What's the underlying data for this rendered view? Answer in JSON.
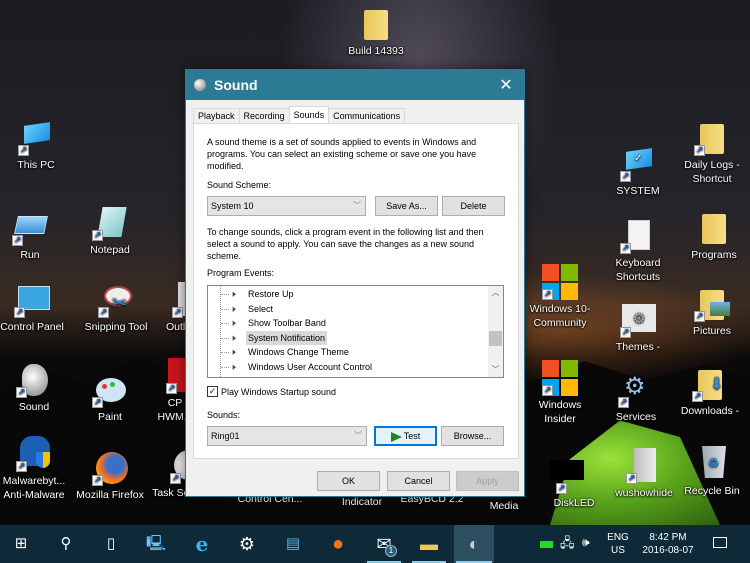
{
  "desktop": {
    "icons": [
      {
        "label": "Build 14393",
        "type": "folder"
      },
      {
        "label": "This PC",
        "type": "pc"
      },
      {
        "label": "Run",
        "type": "run"
      },
      {
        "label": "Notepad",
        "type": "notepad"
      },
      {
        "label": "Control Panel",
        "type": "control-panel"
      },
      {
        "label": "Snipping Tool",
        "type": "snipping-tool"
      },
      {
        "label": "Outl...",
        "type": "outlook"
      },
      {
        "label": "Sound",
        "type": "sound"
      },
      {
        "label": "Paint",
        "type": "paint"
      },
      {
        "label": "CP HWM...",
        "type": "cpuid"
      },
      {
        "label": "Malwarebyt... Anti-Malware",
        "type": "malwarebytes"
      },
      {
        "label": "Mozilla Firefox",
        "type": "firefox"
      },
      {
        "label": "Task Scheduler",
        "type": "task-scheduler"
      },
      {
        "label": "Control Cen...",
        "type": "control-center"
      },
      {
        "label": "Indicator",
        "type": "indicator"
      },
      {
        "label": "EasyBCD 2.2",
        "type": "easybcd"
      },
      {
        "label": "Media",
        "type": "media"
      },
      {
        "label": "SYSTEM",
        "type": "system"
      },
      {
        "label": "Daily Logs - Shortcut",
        "type": "folder"
      },
      {
        "label": "Keyboard Shortcuts",
        "type": "document"
      },
      {
        "label": "Programs",
        "type": "folder"
      },
      {
        "label": "Windows 10- Community",
        "type": "windows-logo"
      },
      {
        "label": "Themes -",
        "type": "themes"
      },
      {
        "label": "Pictures",
        "type": "folder"
      },
      {
        "label": "Windows Insider",
        "type": "windows-logo"
      },
      {
        "label": "Services",
        "type": "services"
      },
      {
        "label": "Downloads -",
        "type": "folder"
      },
      {
        "label": "DiskLED",
        "type": "diskled"
      },
      {
        "label": "wushowhide",
        "type": "wushowhide"
      },
      {
        "label": "Recycle Bin",
        "type": "recycle-bin"
      }
    ]
  },
  "dialog": {
    "title": "Sound",
    "close_glyph": "✕",
    "tabs": [
      {
        "label": "Playback",
        "active": false
      },
      {
        "label": "Recording",
        "active": false
      },
      {
        "label": "Sounds",
        "active": true
      },
      {
        "label": "Communications",
        "active": false
      }
    ],
    "intro_text": "A sound theme is a set of sounds applied to events in Windows and programs.  You can select an existing scheme or save one you have modified.",
    "scheme_label": "Sound Scheme:",
    "scheme_value": "System 10",
    "save_as_label": "Save As...",
    "delete_label": "Delete",
    "change_text": "To change sounds, click a program event in the following list and then select a sound to apply.  You can save the changes as a new sound scheme.",
    "events_label": "Program Events:",
    "events": [
      {
        "label": "Restore Up",
        "selected": false
      },
      {
        "label": "Select",
        "selected": false
      },
      {
        "label": "Show Toolbar Band",
        "selected": false
      },
      {
        "label": "System Notification",
        "selected": true
      },
      {
        "label": "Windows Change Theme",
        "selected": false
      },
      {
        "label": "Windows User Account Control",
        "selected": false
      }
    ],
    "startup_checkbox_label": "Play Windows Startup sound",
    "startup_checked": true,
    "sounds_label": "Sounds:",
    "sound_value": "Ring01",
    "test_label": "Test",
    "browse_label": "Browse...",
    "ok_label": "OK",
    "cancel_label": "Cancel",
    "apply_label": "Apply"
  },
  "taskbar": {
    "items": [
      {
        "name": "start",
        "glyph": "⊞"
      },
      {
        "name": "search",
        "glyph": "⚲"
      },
      {
        "name": "task-view",
        "glyph": "▯"
      },
      {
        "name": "this-pc",
        "glyph": "🖳"
      },
      {
        "name": "internet-explorer",
        "glyph": "e"
      },
      {
        "name": "settings",
        "glyph": "⚙"
      },
      {
        "name": "control-panel",
        "glyph": "▤"
      },
      {
        "name": "firefox",
        "glyph": "●"
      },
      {
        "name": "mail",
        "glyph": "✉",
        "badge": "1"
      },
      {
        "name": "file-explorer",
        "glyph": "▬"
      },
      {
        "name": "sound",
        "glyph": "◐"
      }
    ],
    "language_top": "ENG",
    "language_bottom": "US",
    "time": "8:42 PM",
    "date": "2016-08-07",
    "disk_led_color": "#22dd22"
  }
}
